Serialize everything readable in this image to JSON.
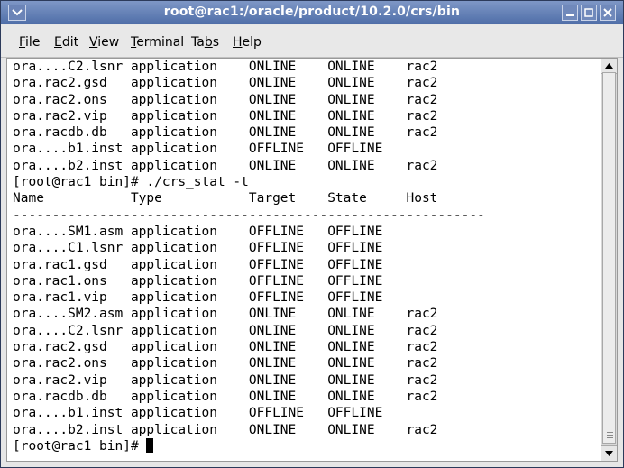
{
  "window": {
    "title": "root@rac1:/oracle/product/10.2.0/crs/bin"
  },
  "menu": {
    "items": [
      {
        "label": "File",
        "mnemonic": "F"
      },
      {
        "label": "Edit",
        "mnemonic": "E"
      },
      {
        "label": "View",
        "mnemonic": "V"
      },
      {
        "label": "Terminal",
        "mnemonic": "T"
      },
      {
        "label": "Tabs",
        "mnemonic": "b"
      },
      {
        "label": "Help",
        "mnemonic": "H"
      }
    ]
  },
  "terminal": {
    "lines": [
      "ora....C2.lsnr application    ONLINE    ONLINE    rac2",
      "ora.rac2.gsd   application    ONLINE    ONLINE    rac2",
      "ora.rac2.ons   application    ONLINE    ONLINE    rac2",
      "ora.rac2.vip   application    ONLINE    ONLINE    rac2",
      "ora.racdb.db   application    ONLINE    ONLINE    rac2",
      "ora....b1.inst application    OFFLINE   OFFLINE",
      "ora....b2.inst application    ONLINE    ONLINE    rac2",
      "[root@rac1 bin]# ./crs_stat -t",
      "Name           Type           Target    State     Host",
      "------------------------------------------------------------",
      "ora....SM1.asm application    OFFLINE   OFFLINE",
      "ora....C1.lsnr application    OFFLINE   OFFLINE",
      "ora.rac1.gsd   application    OFFLINE   OFFLINE",
      "ora.rac1.ons   application    OFFLINE   OFFLINE",
      "ora.rac1.vip   application    OFFLINE   OFFLINE",
      "ora....SM2.asm application    ONLINE    ONLINE    rac2",
      "ora....C2.lsnr application    ONLINE    ONLINE    rac2",
      "ora.rac2.gsd   application    ONLINE    ONLINE    rac2",
      "ora.rac2.ons   application    ONLINE    ONLINE    rac2",
      "ora.rac2.vip   application    ONLINE    ONLINE    rac2",
      "ora.racdb.db   application    ONLINE    ONLINE    rac2",
      "ora....b1.inst application    OFFLINE   OFFLINE",
      "ora....b2.inst application    ONLINE    ONLINE    rac2"
    ],
    "prompt": "[root@rac1 bin]# "
  },
  "icons": {
    "window_menu": "chevron-down-icon",
    "minimize": "minimize-icon",
    "maximize": "maximize-icon",
    "close": "close-icon",
    "scroll_up": "arrow-up-icon",
    "scroll_down": "arrow-down-icon"
  },
  "colors": {
    "titlebar": "#5f7cb2",
    "terminal_bg": "#ffffff",
    "terminal_fg": "#000000"
  }
}
